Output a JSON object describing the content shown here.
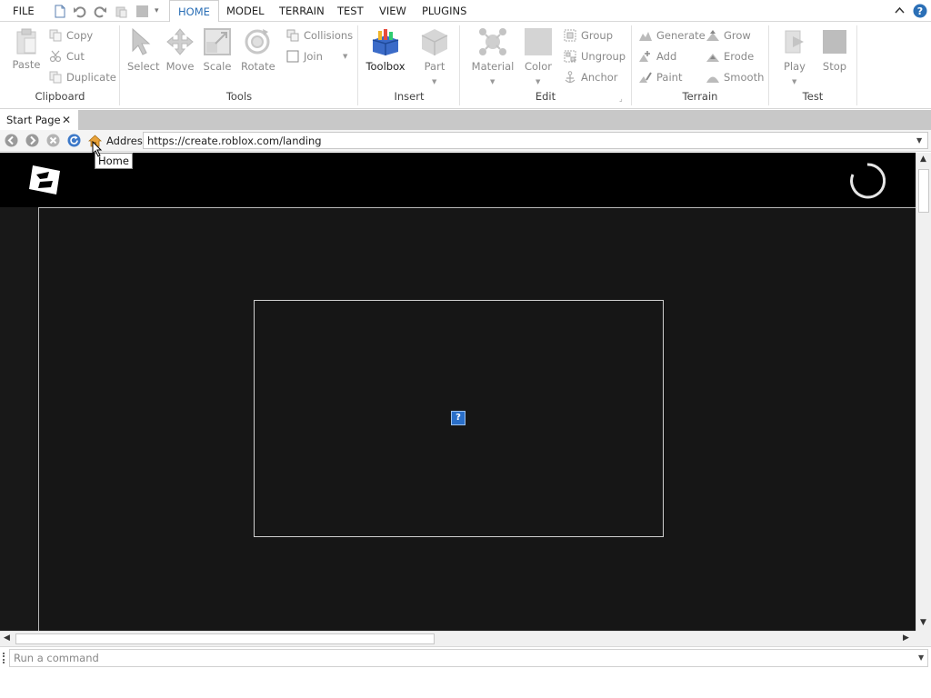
{
  "menubar": {
    "file": "FILE",
    "tabs": [
      "HOME",
      "MODEL",
      "TERRAIN",
      "TEST",
      "VIEW",
      "PLUGINS"
    ],
    "active_tab": "HOME"
  },
  "ribbon": {
    "clipboard": {
      "label": "Clipboard",
      "paste": "Paste",
      "copy": "Copy",
      "cut": "Cut",
      "duplicate": "Duplicate"
    },
    "tools": {
      "label": "Tools",
      "select": "Select",
      "move": "Move",
      "scale": "Scale",
      "rotate": "Rotate",
      "collisions": "Collisions",
      "join": "Join"
    },
    "insert": {
      "label": "Insert",
      "toolbox": "Toolbox",
      "part": "Part"
    },
    "edit": {
      "label": "Edit",
      "material": "Material",
      "color": "Color",
      "group": "Group",
      "ungroup": "Ungroup",
      "anchor": "Anchor"
    },
    "terrain": {
      "label": "Terrain",
      "generate": "Generate",
      "add": "Add",
      "paint": "Paint",
      "grow": "Grow",
      "erode": "Erode",
      "smooth": "Smooth"
    },
    "test": {
      "label": "Test",
      "play": "Play",
      "stop": "Stop"
    }
  },
  "tabstrip": {
    "start_page": "Start Page",
    "close_glyph": "✕"
  },
  "addressbar": {
    "label": "Address",
    "url": "https://create.roblox.com/landing",
    "tooltip": "Home"
  },
  "viewport": {
    "broken_image_glyph": "?"
  },
  "commandbar": {
    "placeholder": "Run a command"
  },
  "colors": {
    "accent": "#2b6fb6",
    "site_header": "#000000",
    "site_body": "#181818"
  }
}
